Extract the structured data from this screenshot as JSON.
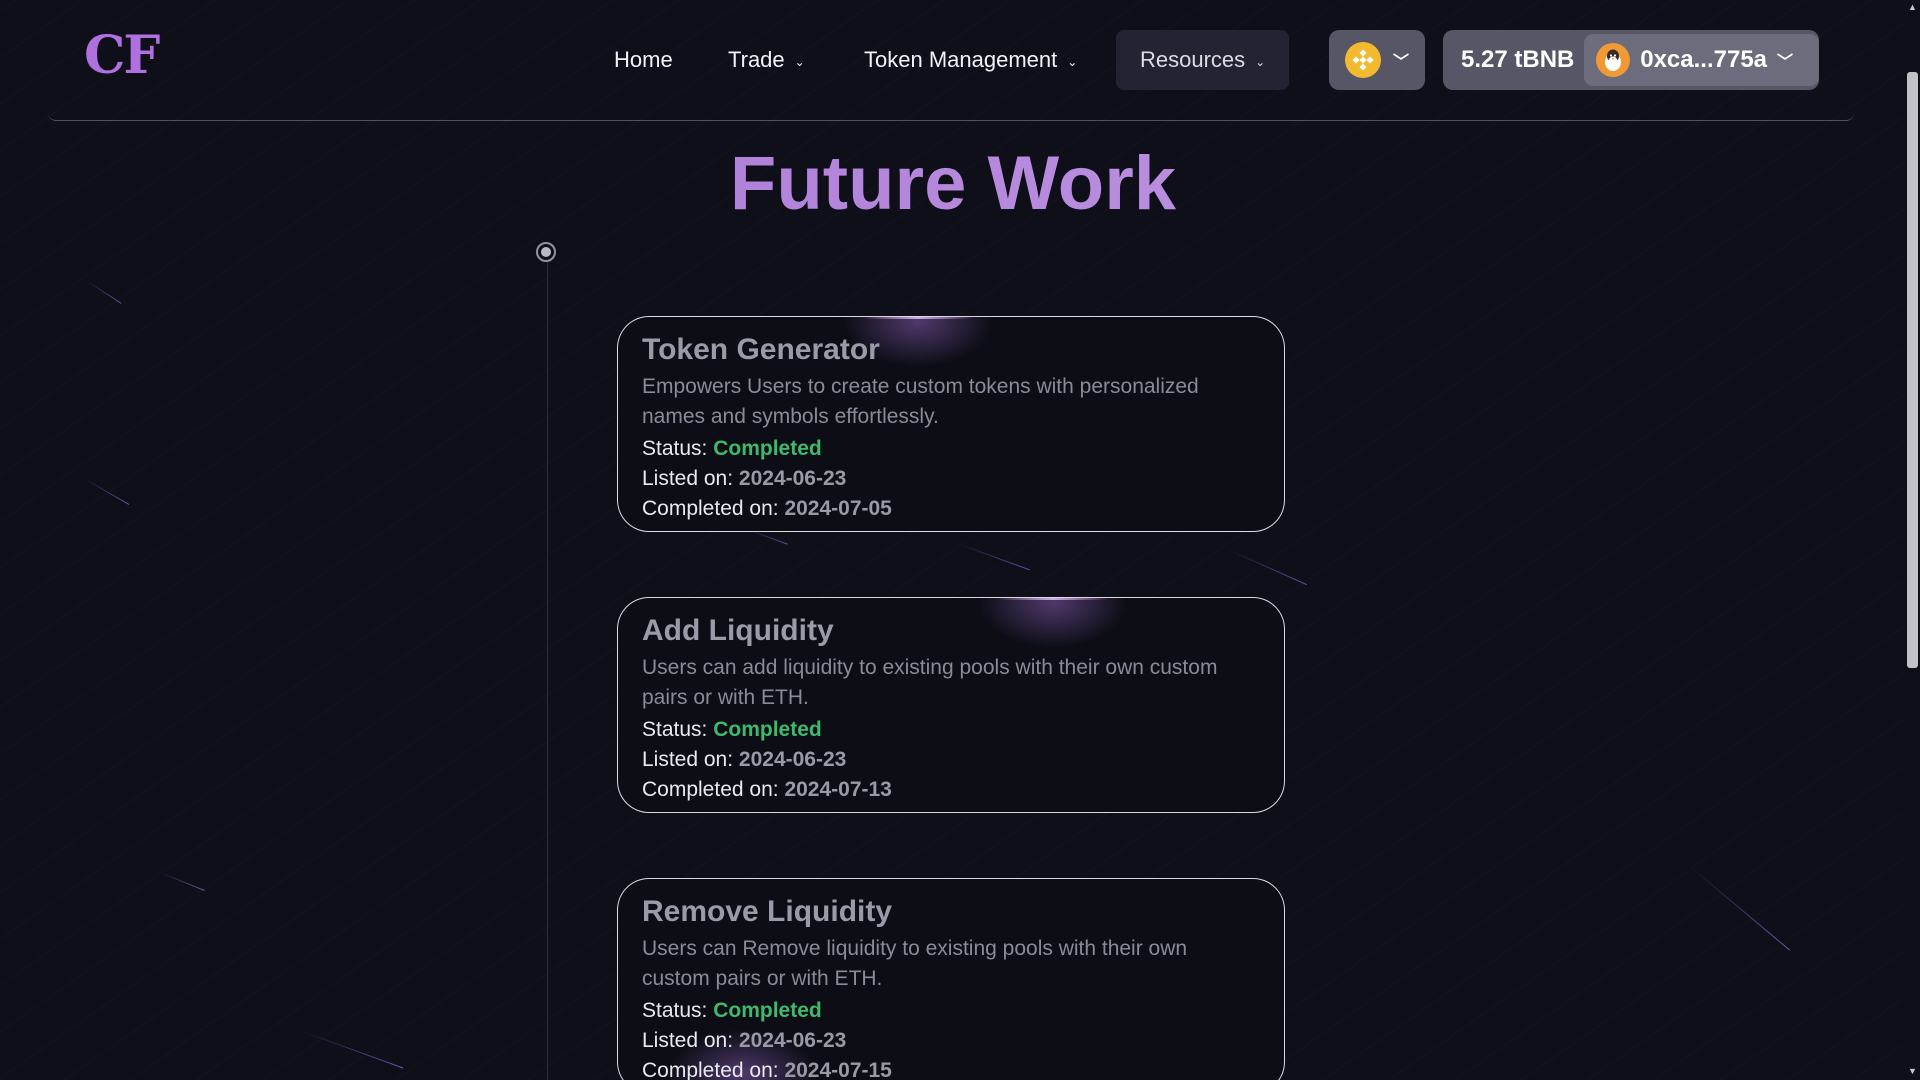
{
  "brand": {
    "logo_text": "CF"
  },
  "nav": {
    "items": [
      {
        "label": "Home",
        "has_dropdown": false
      },
      {
        "label": "Trade",
        "has_dropdown": true
      },
      {
        "label": "Token Management",
        "has_dropdown": true
      },
      {
        "label": "Resources",
        "has_dropdown": true
      }
    ]
  },
  "wallet": {
    "chain_icon": "bnb-icon",
    "balance": "5.27 tBNB",
    "address": "0xca...775a",
    "avatar_icon": "penguin-avatar-icon"
  },
  "page": {
    "title": "Future Work"
  },
  "cards": [
    {
      "title": "Token Generator",
      "description": "Empowers Users to create custom tokens with personalized names and symbols effortlessly.",
      "status_label": "Status:",
      "status_value": "Completed",
      "listed_label": "Listed on:",
      "listed_value": "2024-06-23",
      "completed_label": "Completed on:",
      "completed_value": "2024-07-05"
    },
    {
      "title": "Add Liquidity",
      "description": "Users can add liquidity to existing pools with their own custom pairs or with ETH.",
      "status_label": "Status:",
      "status_value": "Completed",
      "listed_label": "Listed on:",
      "listed_value": "2024-06-23",
      "completed_label": "Completed on:",
      "completed_value": "2024-07-13"
    },
    {
      "title": "Remove Liquidity",
      "description": "Users can Remove liquidity to existing pools with their own custom pairs or with ETH.",
      "status_label": "Status:",
      "status_value": "Completed",
      "listed_label": "Listed on:",
      "listed_value": "2024-06-23",
      "completed_label": "Completed on:",
      "completed_value": "2024-07-15"
    }
  ],
  "colors": {
    "background": "#0f0f1a",
    "accent_purple": "#a46fd4",
    "status_green": "#3dba6c",
    "chain_yellow": "#f3ba2f",
    "avatar_orange": "#f19a35"
  }
}
